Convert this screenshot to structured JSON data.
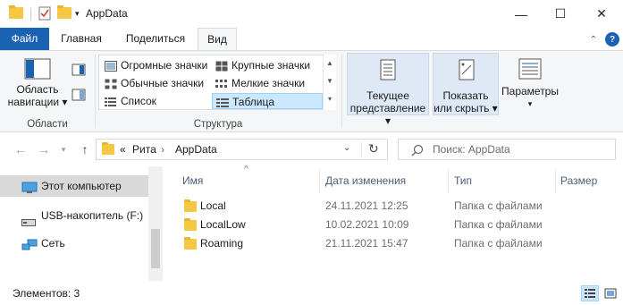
{
  "window": {
    "title": "AppData",
    "controls": {
      "minimize": "—",
      "maximize": "☐",
      "close": "✕"
    }
  },
  "ribbon": {
    "tabs": [
      "Файл",
      "Главная",
      "Поделиться",
      "Вид"
    ],
    "active_tab": "Вид",
    "groups": {
      "areas": {
        "nav_pane_label_line1": "Область",
        "nav_pane_label_line2": "навигации",
        "group_label": "Области"
      },
      "structure": {
        "items": [
          "Огромные значки",
          "Крупные значки",
          "Обычные значки",
          "Мелкие значки",
          "Список",
          "Таблица"
        ],
        "selected": "Таблица",
        "group_label": "Структура"
      },
      "current_view": {
        "line1": "Текущее",
        "line2": "представление"
      },
      "show_hide": {
        "line1": "Показать",
        "line2": "или скрыть"
      },
      "options": {
        "label": "Параметры"
      }
    }
  },
  "address": {
    "overflow": "«",
    "breadcrumb": [
      "Рита",
      "AppData"
    ],
    "separator": "›",
    "search_placeholder": "Поиск: AppData"
  },
  "nav_pane": {
    "items": [
      {
        "label": "Этот компьютер",
        "icon": "computer-icon",
        "selected": true
      },
      {
        "label": "USB-накопитель (F:)",
        "icon": "usb-drive-icon",
        "selected": false
      },
      {
        "label": "Сеть",
        "icon": "network-icon",
        "selected": false
      }
    ]
  },
  "file_list": {
    "columns": [
      "Имя",
      "Дата изменения",
      "Тип",
      "Размер"
    ],
    "sort_indicator": "^",
    "rows": [
      {
        "name": "Local",
        "date": "24.11.2021 12:25",
        "type": "Папка с файлами"
      },
      {
        "name": "LocalLow",
        "date": "10.02.2021 10:09",
        "type": "Папка с файлами"
      },
      {
        "name": "Roaming",
        "date": "21.11.2021 15:47",
        "type": "Папка с файлами"
      }
    ]
  },
  "status": {
    "items_count": "Элементов: 3"
  },
  "colors": {
    "file_tab": "#1a63b3",
    "folder": "#f4c844",
    "selection": "#cce8ff",
    "header_text": "#4c607a"
  }
}
